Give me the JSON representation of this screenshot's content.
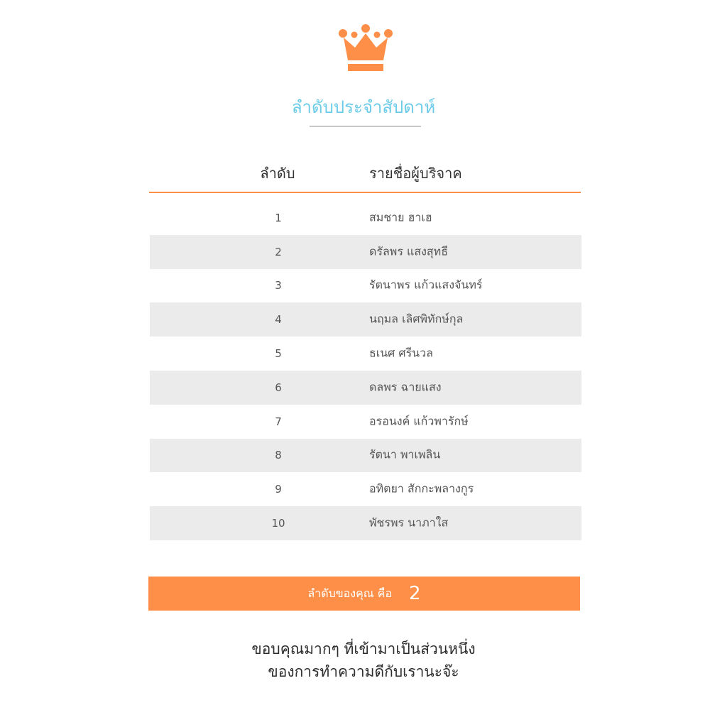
{
  "title": "ลำดับประจำสัปดาห์",
  "icon": "crown-icon",
  "accent_color": "#fd8f48",
  "title_color": "#6ccbe8",
  "table": {
    "columns": {
      "rank": "ลำดับ",
      "name": "รายชื่อผู้บริจาค"
    },
    "rows": [
      {
        "rank": "1",
        "name": "สมชาย ฮาเฮ"
      },
      {
        "rank": "2",
        "name": "ดรัลพร แสงสุทธี"
      },
      {
        "rank": "3",
        "name": "รัตนาพร แก้วแสงจันทร์"
      },
      {
        "rank": "4",
        "name": "นฤมล เลิศพิทักษ์กุล"
      },
      {
        "rank": "5",
        "name": "ธเนศ ศรีนวล"
      },
      {
        "rank": "6",
        "name": "ดลพร ฉายแสง"
      },
      {
        "rank": "7",
        "name": "อรอนงค์ แก้วพารักษ์"
      },
      {
        "rank": "8",
        "name": "รัตนา พาเพลิน"
      },
      {
        "rank": "9",
        "name": "อทิตยา สักกะพลางกูร"
      },
      {
        "rank": "10",
        "name": "พัชรพร นาภาใส"
      }
    ]
  },
  "my_rank": {
    "label": "ลำดับของคุณ คือ",
    "value": "2"
  },
  "thanks": {
    "line1": "ขอบคุณมากๆ ที่เข้ามาเป็นส่วนหนึ่ง",
    "line2": "ของการทำความดีกับเรานะจ๊ะ"
  }
}
